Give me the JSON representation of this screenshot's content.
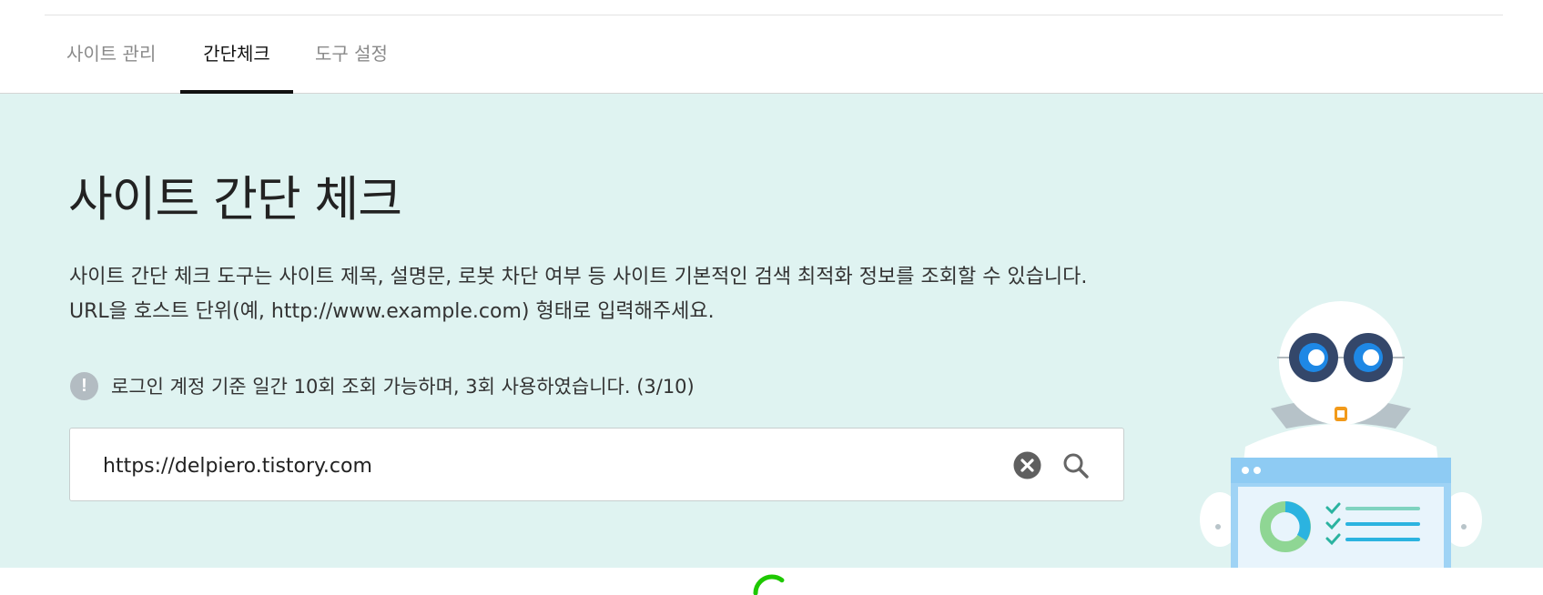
{
  "tabs": [
    {
      "label": "사이트 관리"
    },
    {
      "label": "간단체크"
    },
    {
      "label": "도구 설정"
    }
  ],
  "hero": {
    "title": "사이트 간단 체크",
    "description_line1": "사이트 간단 체크 도구는 사이트 제목, 설명문, 로봇 차단 여부 등 사이트 기본적인 검색 최적화 정보를 조회할 수 있습니다.",
    "description_line2": "URL을 호스트 단위(예, http://www.example.com) 형태로 입력해주세요.",
    "notice": "로그인 계정 기준 일간 10회 조회 가능하며, 3회 사용하였습니다. (3/10)",
    "notice_icon": "exclamation-icon"
  },
  "search": {
    "value": "https://delpiero.tistory.com",
    "clear_icon": "clear-icon",
    "search_icon": "search-icon"
  },
  "colors": {
    "hero_background": "#dff3f1",
    "active_tab": "#111111",
    "inactive_tab": "#8a8a8a",
    "loading_spinner": "#1ec800"
  }
}
